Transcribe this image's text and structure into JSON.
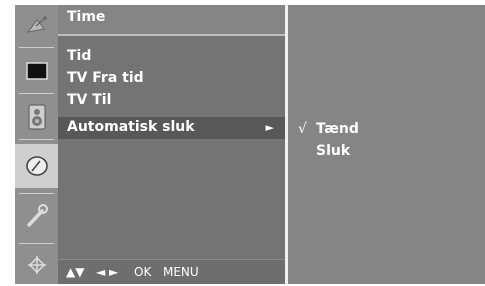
{
  "menu": {
    "title": "Time",
    "items": [
      {
        "label": "Tid"
      },
      {
        "label": "TV Fra tid"
      },
      {
        "label": "TV Til"
      },
      {
        "label": "Automatisk sluk",
        "arrow": "►"
      }
    ]
  },
  "submenu": {
    "check_mark": "√",
    "options": [
      {
        "label": "Tænd"
      },
      {
        "label": "Sluk"
      }
    ]
  },
  "bottom_bar": {
    "nav_updown": "▲▼",
    "nav_leftright": "◄ ►",
    "ok": "OK",
    "menu": "MENU"
  },
  "side_icons": [
    "satellite-dish-icon",
    "screen-icon",
    "speaker-icon",
    "clock-icon",
    "wrench-icon",
    "plug-icon"
  ],
  "active_icon": "clock-icon",
  "colors": {
    "icon_column": "#8f8f8f",
    "menu_background": "#747474",
    "selected_row": "#585858",
    "submenu_background": "#858585"
  }
}
